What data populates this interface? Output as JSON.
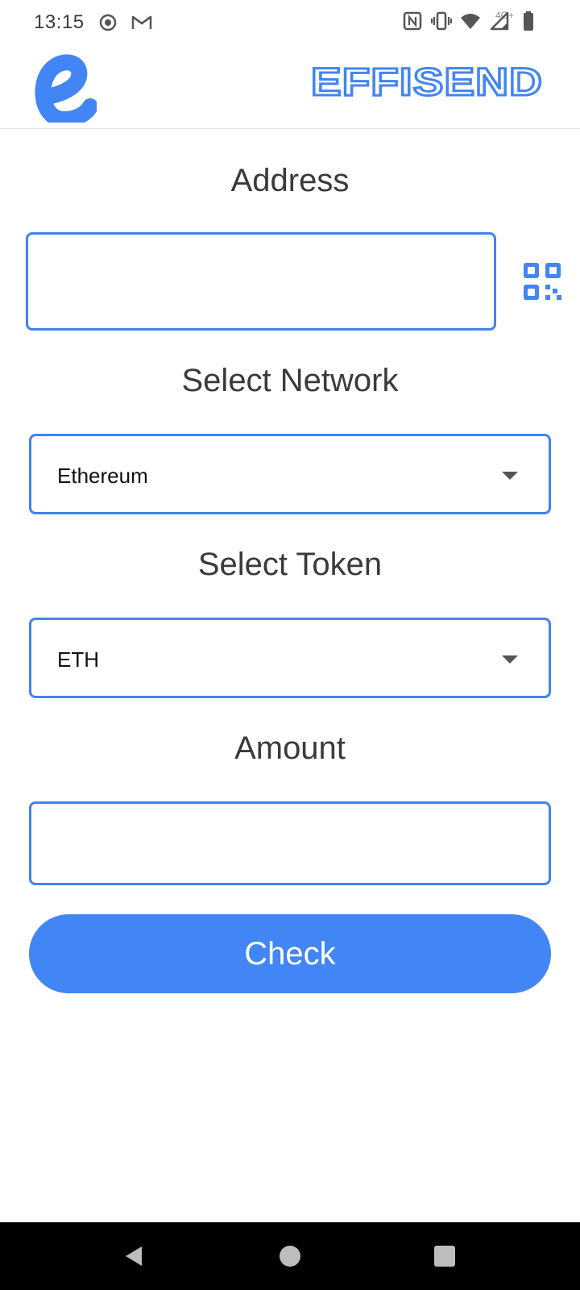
{
  "status_bar": {
    "time": "13:15",
    "left_icons": [
      "screen-record-icon",
      "gmail-icon"
    ],
    "network_label": "4G+",
    "right_icons": [
      "nfc-icon",
      "vibrate-icon",
      "wifi-icon",
      "signal-icon",
      "battery-icon"
    ]
  },
  "header": {
    "logo_icon": "effisend-e-logo",
    "brand_name": "EFFISEND",
    "accent_color": "#3f83f0"
  },
  "form": {
    "address_title": "Address",
    "address_value": "",
    "qr_icon": "qr-code-icon",
    "network_title": "Select Network",
    "network_selected": "Ethereum",
    "token_title": "Select Token",
    "token_selected": "ETH",
    "amount_title": "Amount",
    "amount_value": "",
    "check_label": "Check"
  },
  "nav_bar": {
    "icons": [
      "back-icon",
      "home-icon",
      "recents-icon"
    ]
  }
}
